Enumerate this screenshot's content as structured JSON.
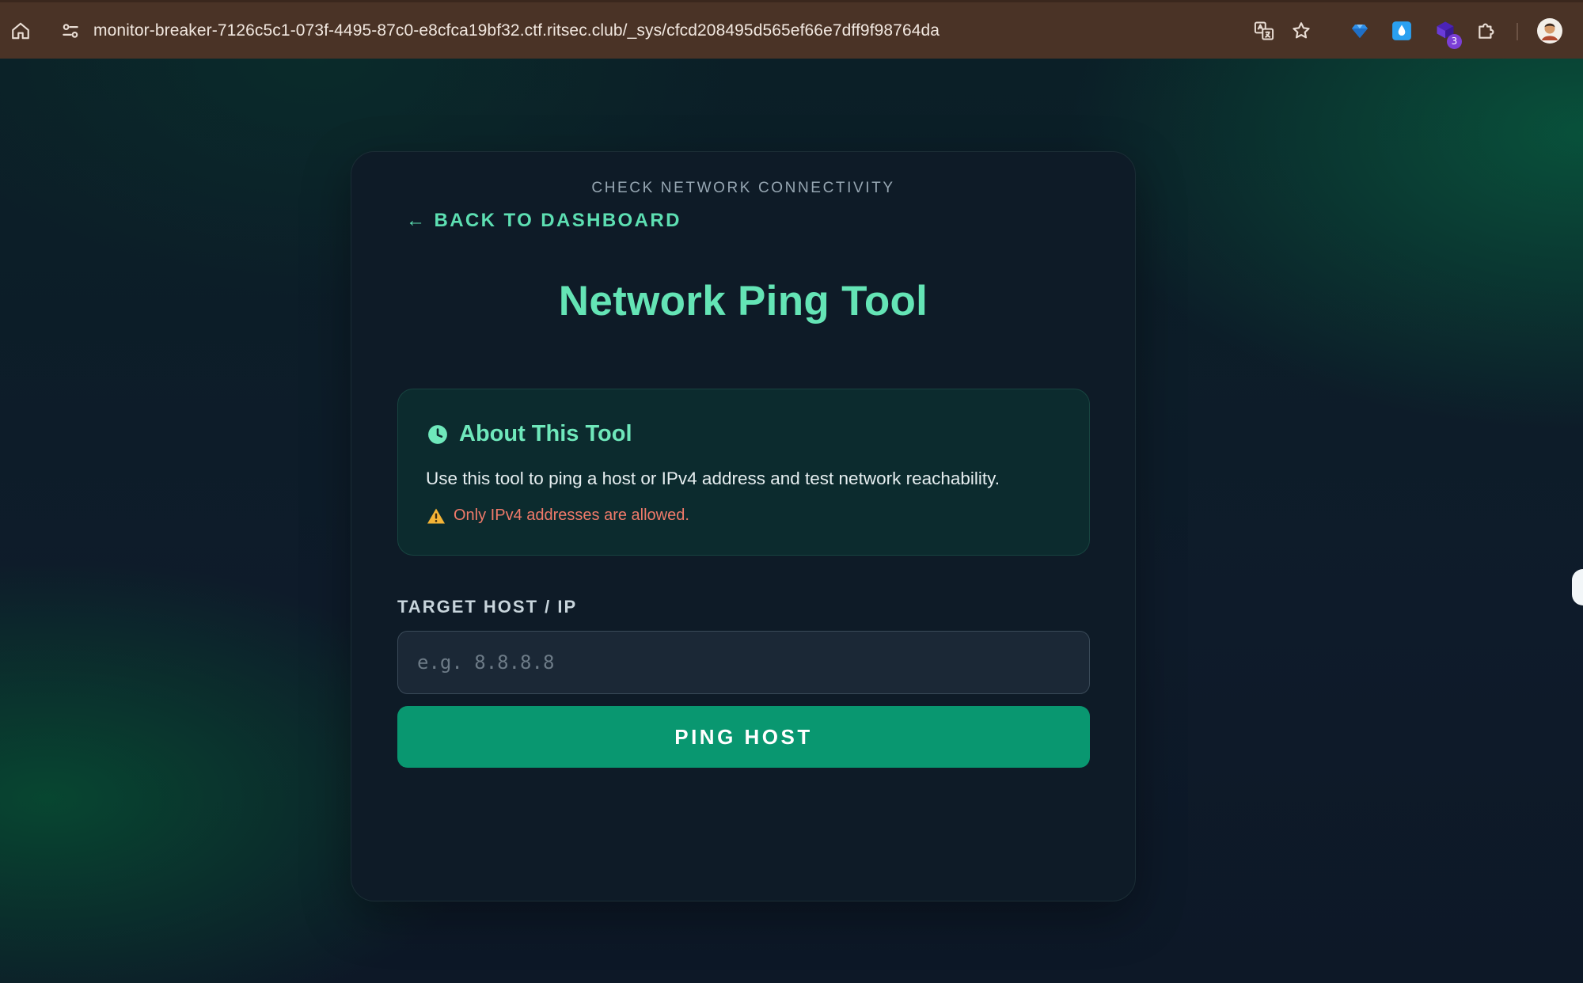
{
  "browser": {
    "url": "monitor-breaker-7126c5c1-073f-4495-87c0-e8cfca19bf32.ctf.ritsec.club/_sys/cfcd208495d565ef66e7dff9f98764da",
    "icons": [
      "home-icon",
      "site-settings-icon",
      "translate-icon",
      "bookmark-star-icon",
      "gem-extension-icon",
      "droplet-extension-icon",
      "purple-extension-icon",
      "extensions-puzzle-icon",
      "profile-avatar-icon"
    ],
    "extension_badge": "3"
  },
  "card": {
    "back_link": "← BACK TO DASHBOARD",
    "title": "Network Ping Tool",
    "subtitle": "CHECK NETWORK CONNECTIVITY"
  },
  "info": {
    "icon": "clock-icon",
    "title": "About This Tool",
    "description": "Use this tool to ping a host or IPv4 address and test network reachability.",
    "warning_icon": "warning-icon",
    "warning": "Only IPv4 addresses are allowed."
  },
  "form": {
    "label": "TARGET HOST / IP",
    "value": "",
    "placeholder": "e.g. 8.8.8.8",
    "button_label": "PING HOST"
  },
  "colors": {
    "accent": "#64e4b5",
    "button": "#099770",
    "warning": "#f07a6a",
    "card_bg": "#0e1b27",
    "browser_bar": "#4a3326"
  }
}
